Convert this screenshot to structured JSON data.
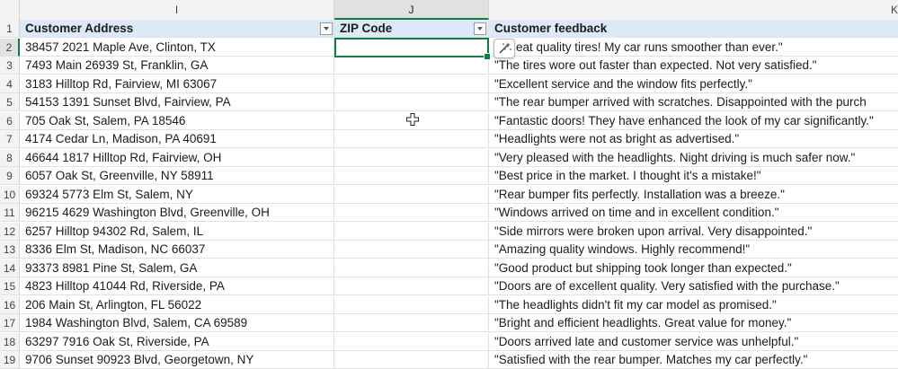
{
  "columns": {
    "I": "I",
    "J": "J",
    "K": "K"
  },
  "header": {
    "address": "Customer Address",
    "zip": "ZIP Code",
    "feedback": "Customer feedback"
  },
  "rows": [
    {
      "num": "2",
      "address": "38457 2021 Maple Ave, Clinton, TX",
      "zip": "",
      "feedback": "eat quality tires! My car runs smoother than ever.\""
    },
    {
      "num": "3",
      "address": "7493 Main 26939 St, Franklin, GA",
      "zip": "",
      "feedback": "\"The tires wore out faster than expected. Not very satisfied.\""
    },
    {
      "num": "4",
      "address": "3183 Hilltop Rd, Fairview, MI 63067",
      "zip": "",
      "feedback": "\"Excellent service and the window fits perfectly.\""
    },
    {
      "num": "5",
      "address": "54153 1391 Sunset Blvd, Fairview, PA",
      "zip": "",
      "feedback": "\"The rear bumper arrived with scratches. Disappointed with the purch"
    },
    {
      "num": "6",
      "address": "705 Oak St, Salem, PA 18546",
      "zip": "",
      "feedback": "\"Fantastic doors! They have enhanced the look of my car significantly.\""
    },
    {
      "num": "7",
      "address": "4174 Cedar Ln, Madison, PA 40691",
      "zip": "",
      "feedback": "\"Headlights were not as bright as advertised.\""
    },
    {
      "num": "8",
      "address": "46644 1817 Hilltop Rd, Fairview, OH",
      "zip": "",
      "feedback": "\"Very pleased with the headlights. Night driving is much safer now.\""
    },
    {
      "num": "9",
      "address": "6057 Oak St, Greenville, NY 58911",
      "zip": "",
      "feedback": "\"Best price in the market. I thought it's a mistake!\""
    },
    {
      "num": "10",
      "address": "69324 5773 Elm St, Salem, NY",
      "zip": "",
      "feedback": "\"Rear bumper fits perfectly. Installation was a breeze.\""
    },
    {
      "num": "11",
      "address": "96215 4629 Washington Blvd, Greenville, OH",
      "zip": "",
      "feedback": "\"Windows arrived on time and in excellent condition.\""
    },
    {
      "num": "12",
      "address": "6257 Hilltop 94302 Rd, Salem, IL",
      "zip": "",
      "feedback": "\"Side mirrors were broken upon arrival. Very disappointed.\""
    },
    {
      "num": "13",
      "address": "8336 Elm St, Madison, NC 66037",
      "zip": "",
      "feedback": "\"Amazing quality windows. Highly recommend!\""
    },
    {
      "num": "14",
      "address": "93373 8981 Pine St, Salem, GA",
      "zip": "",
      "feedback": "\"Good product but shipping took longer than expected.\""
    },
    {
      "num": "15",
      "address": "4823 Hilltop 41044 Rd, Riverside, PA",
      "zip": "",
      "feedback": "\"Doors are of excellent quality. Very satisfied with the purchase.\""
    },
    {
      "num": "16",
      "address": "206 Main St, Arlington, FL 56022",
      "zip": "",
      "feedback": "\"The headlights didn't fit my car model as promised.\""
    },
    {
      "num": "17",
      "address": "1984 Washington Blvd, Salem, CA 69589",
      "zip": "",
      "feedback": "\"Bright and efficient headlights. Great value for money.\""
    },
    {
      "num": "18",
      "address": "63297 7916 Oak St, Riverside, PA",
      "zip": "",
      "feedback": "\"Doors arrived late and customer service was unhelpful.\""
    },
    {
      "num": "19",
      "address": "9706 Sunset 90923 Blvd, Georgetown, NY",
      "zip": "",
      "feedback": "\"Satisfied with the rear bumper. Matches my car perfectly.\""
    }
  ],
  "row1": "1",
  "icons": {
    "quick_analysis": "magic-wand-icon",
    "filter": "dropdown-arrow-icon",
    "cursor": "plus-cursor-icon"
  },
  "colors": {
    "selection": "#107c41",
    "header_fill": "#dde9f7"
  }
}
